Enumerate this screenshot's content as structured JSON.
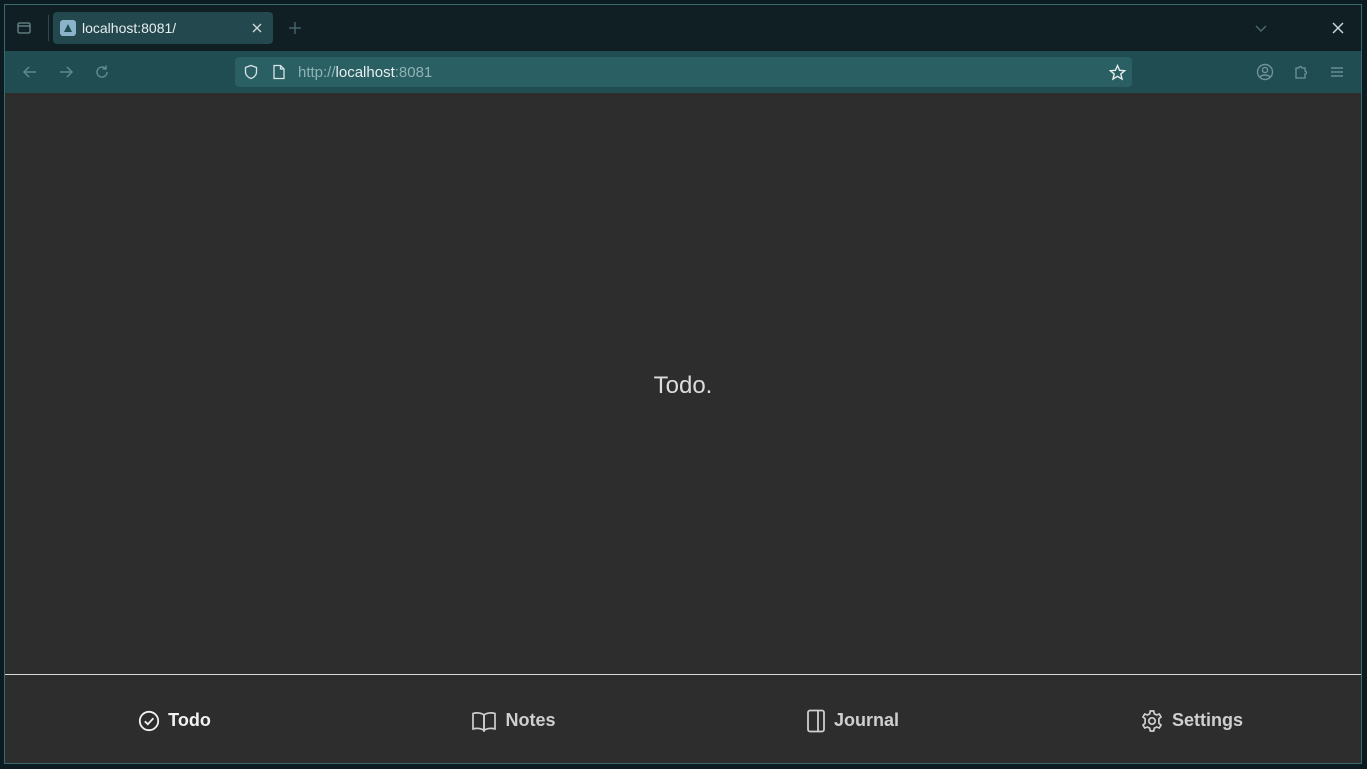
{
  "browser": {
    "tab": {
      "title": "localhost:8081/"
    },
    "url": {
      "scheme": "http://",
      "host": "localhost",
      "port": ":8081"
    }
  },
  "content": {
    "placeholder": "Todo."
  },
  "bottom_nav": {
    "items": [
      {
        "label": "Todo",
        "icon": "check-circle-icon",
        "active": true
      },
      {
        "label": "Notes",
        "icon": "book-open-icon",
        "active": false
      },
      {
        "label": "Journal",
        "icon": "notebook-icon",
        "active": false
      },
      {
        "label": "Settings",
        "icon": "gear-icon",
        "active": false
      }
    ]
  },
  "colors": {
    "tabstrip": "#0f1f24",
    "navbar": "#1f4d52",
    "urlbar": "#2a5f63",
    "page_background": "#2d2d2d",
    "divider": "#d9d9d9"
  }
}
